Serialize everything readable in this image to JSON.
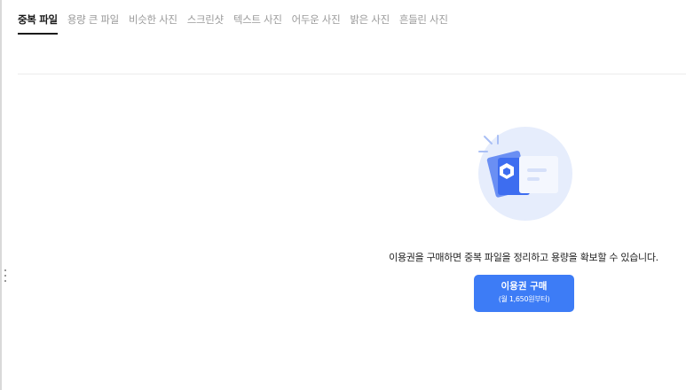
{
  "tabs": [
    {
      "label": "중복 파일",
      "active": true
    },
    {
      "label": "용량 큰 파일",
      "active": false
    },
    {
      "label": "비슷한 사진",
      "active": false
    },
    {
      "label": "스크린샷",
      "active": false
    },
    {
      "label": "텍스트 사진",
      "active": false
    },
    {
      "label": "어두운 사진",
      "active": false
    },
    {
      "label": "밝은 사진",
      "active": false
    },
    {
      "label": "흔들린 사진",
      "active": false
    }
  ],
  "empty_state": {
    "illustration_icon": "file-cleanup-icon",
    "message": "이용권을 구매하면 중복 파일을 정리하고 용량을 확보할 수 있습니다.",
    "buy_button": {
      "label": "이용권 구매",
      "price_note": "(월 1,650원부터)"
    }
  },
  "colors": {
    "accent": "#3d7cf6",
    "illustration_bg": "#e6edfc",
    "card_blue": "#3d6df0",
    "tab_active": "#1a1a1a",
    "tab_inactive": "#9a9a9a"
  }
}
